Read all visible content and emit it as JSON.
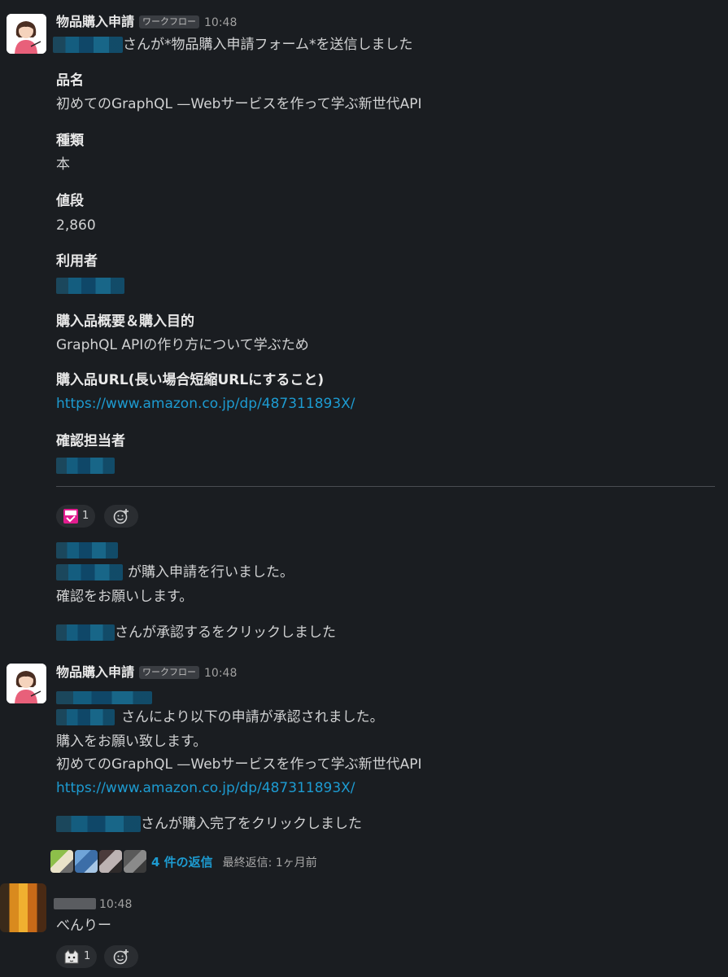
{
  "message1": {
    "sender": "物品購入申請",
    "badge": "ワークフロー",
    "time": "10:48",
    "intro": "さんが*物品購入申請フォーム*を送信しました",
    "fields": [
      {
        "label": "品名",
        "value": "初めてのGraphQL —Webサービスを作って学ぶ新世代API"
      },
      {
        "label": "種類",
        "value": "本"
      },
      {
        "label": "値段",
        "value": "2,860"
      },
      {
        "label": "利用者",
        "value": ""
      },
      {
        "label": "購入品概要＆購入目的",
        "value": "GraphQL APIの作り方について学ぶため"
      },
      {
        "label": "購入品URL(長い場合短縮URLにすること)",
        "value": "https://www.amazon.co.jp/dp/487311893X/"
      },
      {
        "label": "確認担当者",
        "value": ""
      }
    ],
    "reaction_count": "1",
    "notify_line1": "が購入申請を行いました。",
    "notify_line2": "確認をお願いします。",
    "approve_click": "さんが承認するをクリックしました"
  },
  "message2": {
    "sender": "物品購入申請",
    "badge": "ワークフロー",
    "time": "10:48",
    "line1": "さんにより以下の申請が承認されました。",
    "line2": "購入をお願い致します。",
    "line3": "初めてのGraphQL —Webサービスを作って学ぶ新世代API",
    "url": "https://www.amazon.co.jp/dp/487311893X/",
    "complete_click": "さんが購入完了をクリックしました",
    "replies_link": "4 件の返信",
    "last_reply": "最終返信: 1ヶ月前"
  },
  "message3": {
    "time": "10:48",
    "text": "べんりー",
    "reaction_count": "1"
  },
  "colors": {
    "background": "#1a1d21",
    "link": "#1d9bd1",
    "text": "#d1d2d3"
  }
}
